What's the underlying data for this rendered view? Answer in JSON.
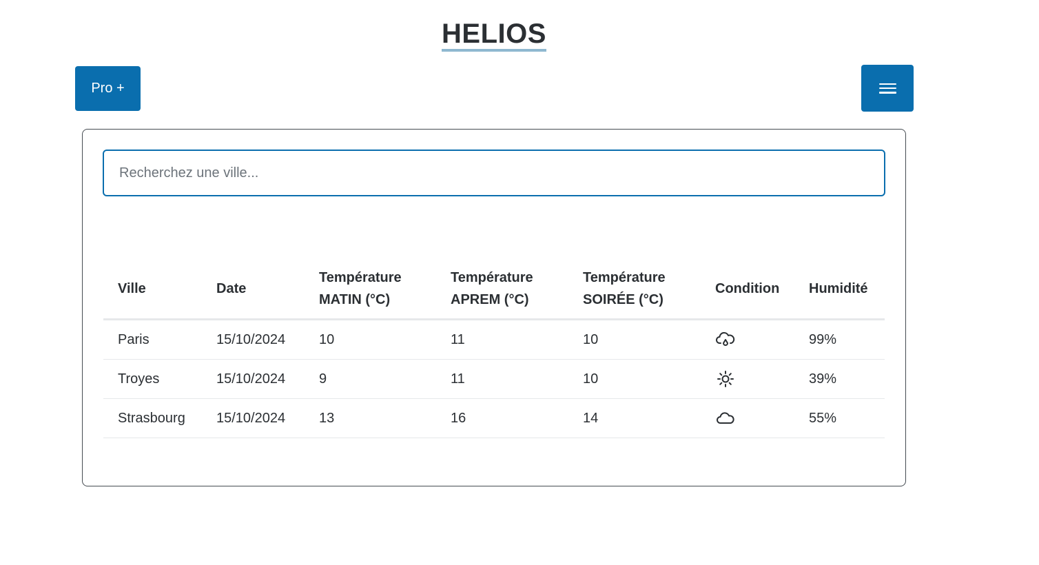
{
  "header": {
    "title": "HELIOS",
    "pro_button_label": "Pro +",
    "menu_icon": "hamburger-menu-icon"
  },
  "search": {
    "placeholder": "Recherchez une ville...",
    "value": ""
  },
  "table": {
    "columns": [
      {
        "line1": "Ville",
        "line2": ""
      },
      {
        "line1": "Date",
        "line2": ""
      },
      {
        "line1": "Température",
        "line2": "MATIN (°C)"
      },
      {
        "line1": "Température",
        "line2": "APREM (°C)"
      },
      {
        "line1": "Température",
        "line2": "SOIRÉE (°C)"
      },
      {
        "line1": "Condition",
        "line2": ""
      },
      {
        "line1": "Humidité",
        "line2": ""
      }
    ],
    "rows": [
      {
        "ville": "Paris",
        "date": "15/10/2024",
        "matin": "10",
        "aprem": "11",
        "soiree": "10",
        "condition_icon": "cloud-rain-icon",
        "humidite": "99%"
      },
      {
        "ville": "Troyes",
        "date": "15/10/2024",
        "matin": "9",
        "aprem": "11",
        "soiree": "10",
        "condition_icon": "sun-icon",
        "humidite": "39%"
      },
      {
        "ville": "Strasbourg",
        "date": "15/10/2024",
        "matin": "13",
        "aprem": "16",
        "soiree": "14",
        "condition_icon": "cloud-icon",
        "humidite": "55%"
      }
    ]
  },
  "colors": {
    "primary": "#0a6eae",
    "title_underline": "#8fb8d0",
    "text": "#2b2f33"
  }
}
